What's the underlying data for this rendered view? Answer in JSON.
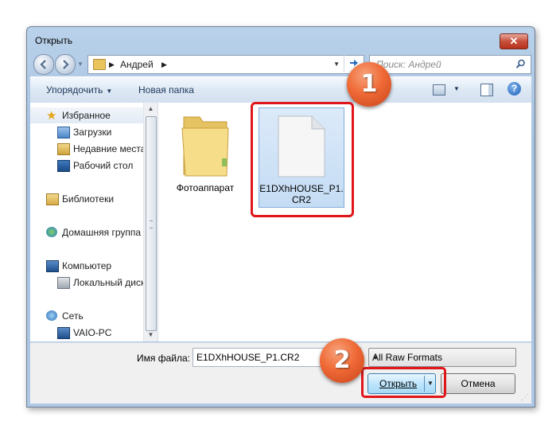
{
  "window": {
    "title": "Открыть",
    "close_glyph": "✕"
  },
  "navbar": {
    "path": [
      "Андрей"
    ],
    "search_placeholder": "Поиск: Андрей"
  },
  "toolbar": {
    "organize_label": "Упорядочить",
    "new_folder_label": "Новая папка",
    "help_glyph": "?"
  },
  "sidebar": {
    "items": [
      {
        "label": "Избранное",
        "icon": "star-icon"
      },
      {
        "label": "Загрузки",
        "icon": "downloads-icon"
      },
      {
        "label": "Недавние места",
        "icon": "recent-places-icon"
      },
      {
        "label": "Рабочий стол",
        "icon": "desktop-icon"
      },
      {
        "label": "Библиотеки",
        "icon": "libraries-icon"
      },
      {
        "label": "Домашняя группа",
        "icon": "homegroup-icon"
      },
      {
        "label": "Компьютер",
        "icon": "computer-icon"
      },
      {
        "label": "Локальный диск",
        "icon": "local-disk-icon"
      },
      {
        "label": "Сеть",
        "icon": "network-icon"
      },
      {
        "label": "VAIO-PC",
        "icon": "pc-icon"
      }
    ]
  },
  "files": [
    {
      "name": "Фотоаппарат",
      "type": "folder"
    },
    {
      "name_line1": "E1DXhHOUSE_P1.",
      "name_line2": "CR2",
      "type": "file",
      "selected": true
    }
  ],
  "footer": {
    "filename_label": "Имя файла:",
    "filename_value": "E1DXhHOUSE_P1.CR2",
    "filter_value": "All Raw Formats",
    "open_label": "Открыть",
    "cancel_label": "Отмена"
  },
  "annotations": {
    "badge1": "1",
    "badge2": "2",
    "highlight_color": "#e0161b",
    "badge_color": "#ef6a36"
  }
}
